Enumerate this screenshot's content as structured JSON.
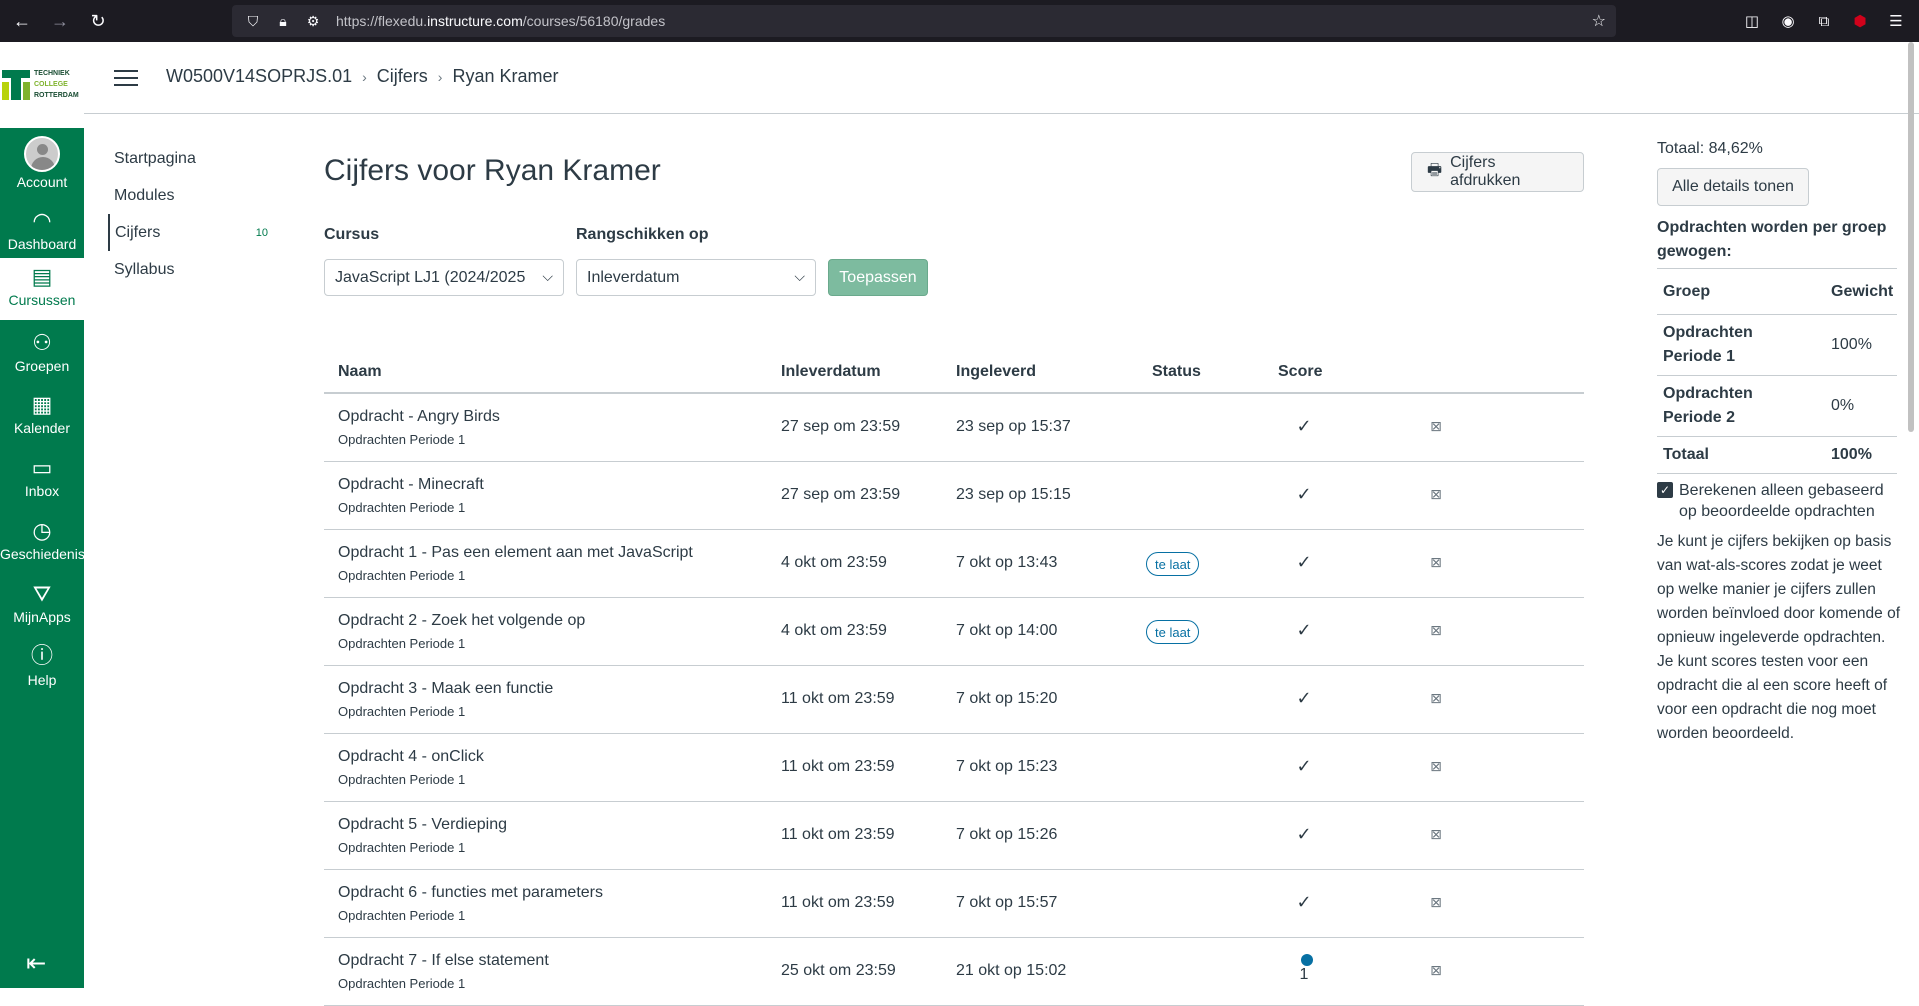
{
  "browser": {
    "url_prefix": "https://flexedu.",
    "url_domain": "instructure.com",
    "url_path": "/courses/56180/grades"
  },
  "logo": {
    "line1": "TECHNIEK",
    "line2": "COLLEGE",
    "line3": "ROTTERDAM"
  },
  "global_nav": [
    {
      "label": "Account",
      "icon": "account-avatar-icon"
    },
    {
      "label": "Dashboard",
      "icon": "dashboard-icon"
    },
    {
      "label": "Cursussen",
      "icon": "courses-icon",
      "active": true
    },
    {
      "label": "Groepen",
      "icon": "groups-icon"
    },
    {
      "label": "Kalender",
      "icon": "calendar-icon"
    },
    {
      "label": "Inbox",
      "icon": "inbox-icon"
    },
    {
      "label": "Geschiedenis",
      "icon": "history-icon"
    },
    {
      "label": "MijnApps",
      "icon": "apps-icon"
    },
    {
      "label": "Help",
      "icon": "help-icon"
    }
  ],
  "breadcrumb": [
    "W0500V14SOPRJS.01",
    "Cijfers",
    "Ryan Kramer"
  ],
  "course_nav": [
    {
      "label": "Startpagina"
    },
    {
      "label": "Modules"
    },
    {
      "label": "Cijfers",
      "badge": "10",
      "active": true
    },
    {
      "label": "Syllabus"
    }
  ],
  "page": {
    "title": "Cijfers voor Ryan Kramer",
    "print_label": "Cijfers afdrukken",
    "course_label": "Cursus",
    "course_value": "JavaScript LJ1 (2024/2025",
    "sort_label": "Rangschikken op",
    "sort_value": "Inleverdatum",
    "apply_label": "Toepassen"
  },
  "table": {
    "headers": {
      "name": "Naam",
      "due": "Inleverdatum",
      "submitted": "Ingeleverd",
      "status": "Status",
      "score": "Score"
    },
    "rows": [
      {
        "name": "Opdracht - Angry Birds",
        "group": "Opdrachten Periode 1",
        "due": "27 sep om 23:59",
        "submitted": "23 sep op 15:37",
        "status": "",
        "score": "✓"
      },
      {
        "name": "Opdracht - Minecraft",
        "group": "Opdrachten Periode 1",
        "due": "27 sep om 23:59",
        "submitted": "23 sep op 15:15",
        "status": "",
        "score": "✓"
      },
      {
        "name": "Opdracht 1 - Pas een element aan met JavaScript",
        "group": "Opdrachten Periode 1",
        "due": "4 okt om 23:59",
        "submitted": "7 okt op 13:43",
        "status": "te laat",
        "score": "✓"
      },
      {
        "name": "Opdracht 2 - Zoek het volgende op",
        "group": "Opdrachten Periode 1",
        "due": "4 okt om 23:59",
        "submitted": "7 okt op 14:00",
        "status": "te laat",
        "score": "✓"
      },
      {
        "name": "Opdracht 3 - Maak een functie",
        "group": "Opdrachten Periode 1",
        "due": "11 okt om 23:59",
        "submitted": "7 okt op 15:20",
        "status": "",
        "score": "✓"
      },
      {
        "name": "Opdracht 4 - onClick",
        "group": "Opdrachten Periode 1",
        "due": "11 okt om 23:59",
        "submitted": "7 okt op 15:23",
        "status": "",
        "score": "✓"
      },
      {
        "name": "Opdracht 5 - Verdieping",
        "group": "Opdrachten Periode 1",
        "due": "11 okt om 23:59",
        "submitted": "7 okt op 15:26",
        "status": "",
        "score": "✓"
      },
      {
        "name": "Opdracht 6 - functies met parameters",
        "group": "Opdrachten Periode 1",
        "due": "11 okt om 23:59",
        "submitted": "7 okt op 15:57",
        "status": "",
        "score": "✓"
      },
      {
        "name": "Opdracht 7 - If else statement",
        "group": "Opdrachten Periode 1",
        "due": "25 okt om 23:59",
        "submitted": "21 okt op 15:02",
        "status": "",
        "score": "1",
        "unread_dot": true
      }
    ]
  },
  "side": {
    "total": "Totaal: 84,62%",
    "details_label": "Alle details tonen",
    "weight_heading": "Opdrachten worden per groep gewogen:",
    "weight_header": {
      "group": "Groep",
      "weight": "Gewicht"
    },
    "weights": [
      {
        "group": "Opdrachten Periode 1",
        "weight": "100%"
      },
      {
        "group": "Opdrachten Periode 2",
        "weight": "0%"
      }
    ],
    "weight_total": {
      "group": "Totaal",
      "weight": "100%"
    },
    "checkbox_label": "Berekenen alleen gebaseerd op beoordeelde opdrachten",
    "info": "Je kunt je cijfers bekijken op basis van wat-als-scores zodat je weet op welke manier je cijfers zullen worden beïnvloed door komende of opnieuw ingeleverde opdrachten. Je kunt scores testen voor een opdracht die al een score heeft of voor een opdracht die nog moet worden beoordeeld."
  },
  "colors": {
    "brand": "#007a4d",
    "link": "#0770a3",
    "text": "#2d3b45",
    "apply": "#7dbb9f"
  }
}
